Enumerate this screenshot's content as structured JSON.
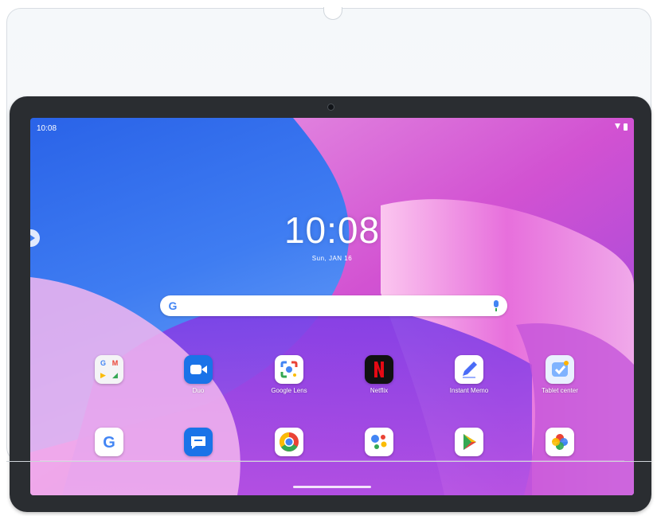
{
  "status_bar": {
    "time": "10:08"
  },
  "lock": {
    "clock": "10:08",
    "date": "Sun, JAN 16"
  },
  "search": {
    "logo": "G"
  },
  "apps": [
    {
      "name": "Google folder",
      "label": "",
      "icon": "google-folder-icon"
    },
    {
      "name": "Duo",
      "label": "Duo",
      "icon": "duo-icon"
    },
    {
      "name": "Google Lens",
      "label": "Google Lens",
      "icon": "google-lens-icon"
    },
    {
      "name": "Netflix",
      "label": "Netflix",
      "icon": "netflix-icon"
    },
    {
      "name": "Instant Memo",
      "label": "Instant Memo",
      "icon": "instant-memo-icon"
    },
    {
      "name": "Tablet center",
      "label": "Tablet center",
      "icon": "tablet-center-icon"
    }
  ],
  "dock": [
    {
      "name": "Google",
      "icon": "google-icon"
    },
    {
      "name": "Messages",
      "icon": "messages-icon"
    },
    {
      "name": "Chrome",
      "icon": "chrome-icon"
    },
    {
      "name": "Assistant",
      "icon": "assistant-icon"
    },
    {
      "name": "Play Store",
      "icon": "play-store-icon"
    },
    {
      "name": "Photos",
      "icon": "photos-icon"
    }
  ],
  "colors": {
    "bezel": "#2a2d31",
    "wallpaper_blue": "#3f7df2",
    "wallpaper_pink": "#e35fd0"
  }
}
